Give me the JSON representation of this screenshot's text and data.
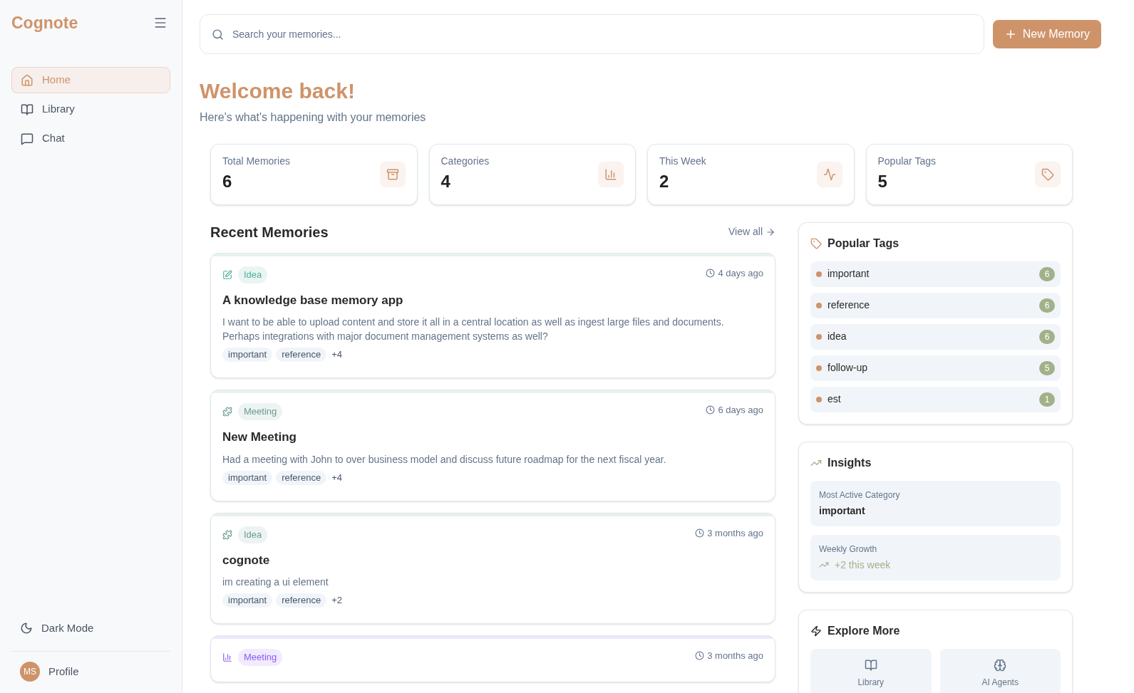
{
  "sidebar": {
    "logo": "Cognote",
    "items": [
      {
        "label": "Home",
        "selected": true
      },
      {
        "label": "Library",
        "selected": false
      },
      {
        "label": "Chat",
        "selected": false
      }
    ],
    "dark_mode": "Dark Mode",
    "profile": {
      "initials": "MS",
      "label": "Profile"
    }
  },
  "search": {
    "placeholder": "Search your memories..."
  },
  "new_button": "New Memory",
  "heading": "Welcome back!",
  "subheading": "Here's what's happening with your memories",
  "stats": [
    {
      "label": "Total Memories",
      "value": "6"
    },
    {
      "label": "Categories",
      "value": "4"
    },
    {
      "label": "This Week",
      "value": "2"
    },
    {
      "label": "Popular Tags",
      "value": "5"
    }
  ],
  "recent": {
    "title": "Recent Memories",
    "view_all": "View all",
    "cards": [
      {
        "kind": "pencil",
        "category": "Idea",
        "color": "#4fae9a",
        "time": "4 days ago",
        "title": "A knowledge base memory app",
        "body": "I want to be able to upload content and store it all in a central location as well as ingest large files and documents. Perhaps integrations with major document management systems as well?",
        "tags": [
          "important",
          "reference"
        ],
        "more": "+4"
      },
      {
        "kind": "puzzle",
        "category": "Meeting",
        "color": "#6a9a92",
        "time": "6 days ago",
        "title": "New Meeting",
        "body": "Had a meeting with John to over business model and discuss future roadmap for the next fiscal year.",
        "tags": [
          "important",
          "reference"
        ],
        "more": "+4"
      },
      {
        "kind": "puzzle",
        "category": "Idea",
        "color": "#6a9a92",
        "time": "3 months ago",
        "title": "cognote",
        "body": "im creating a ui element",
        "tags": [
          "important",
          "reference"
        ],
        "more": "+2"
      },
      {
        "kind": "chart",
        "category": "Meeting",
        "color": "#8b5cf6",
        "time": "3 months ago"
      }
    ]
  },
  "popular_tags": {
    "title": "Popular Tags",
    "items": [
      {
        "name": "important",
        "count": "6"
      },
      {
        "name": "reference",
        "count": "6"
      },
      {
        "name": "idea",
        "count": "6"
      },
      {
        "name": "follow-up",
        "count": "5"
      },
      {
        "name": "est",
        "count": "1"
      }
    ]
  },
  "insights": {
    "title": "Insights",
    "most_active_label": "Most Active Category",
    "most_active_value": "important",
    "growth_label": "Weekly Growth",
    "growth_value": "+2 this week"
  },
  "explore": {
    "title": "Explore More",
    "items": [
      {
        "label": "Library"
      },
      {
        "label": "AI Agents"
      }
    ]
  }
}
